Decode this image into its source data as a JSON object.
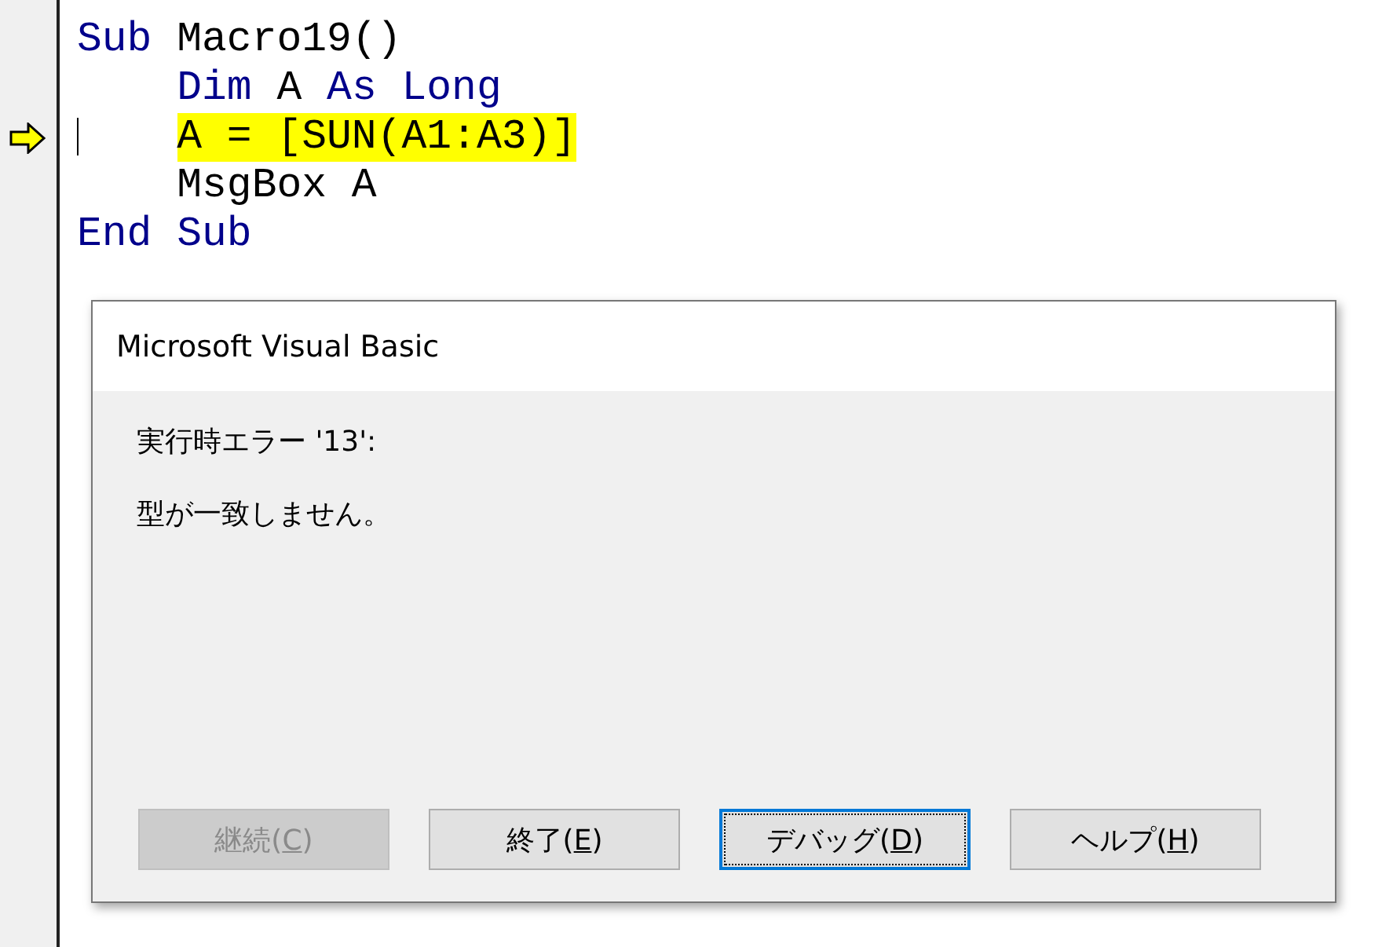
{
  "code_lines": [
    {
      "current": false,
      "highlighted": false,
      "indented": false,
      "tokens": [
        {
          "kind": "keyword",
          "text": "Sub "
        },
        {
          "kind": "text",
          "text": "Macro19()"
        }
      ]
    },
    {
      "current": false,
      "highlighted": false,
      "indented": true,
      "tokens": [
        {
          "kind": "keyword",
          "text": "Dim "
        },
        {
          "kind": "text",
          "text": "A "
        },
        {
          "kind": "keyword",
          "text": "As Long"
        }
      ]
    },
    {
      "current": true,
      "highlighted": true,
      "indented": true,
      "tokens": [
        {
          "kind": "text",
          "text": "A = [SUN(A1:A3)]"
        }
      ]
    },
    {
      "current": false,
      "highlighted": false,
      "indented": true,
      "tokens": [
        {
          "kind": "text",
          "text": "MsgBox A"
        }
      ]
    },
    {
      "current": false,
      "highlighted": false,
      "indented": false,
      "tokens": [
        {
          "kind": "keyword",
          "text": "End Sub"
        }
      ]
    }
  ],
  "dialog": {
    "title": "Microsoft Visual Basic",
    "messages": [
      "実行時エラー '13':",
      "型が一致しません。"
    ],
    "buttons": [
      {
        "before": "継続(",
        "accel": "C",
        "after": ")",
        "disabled": true,
        "focused": false
      },
      {
        "before": "終了(",
        "accel": "E",
        "after": ")",
        "disabled": false,
        "focused": false
      },
      {
        "before": "デバッグ(",
        "accel": "D",
        "after": ")",
        "disabled": false,
        "focused": true
      },
      {
        "before": "ヘルプ(",
        "accel": "H",
        "after": ")",
        "disabled": false,
        "focused": false
      }
    ]
  }
}
